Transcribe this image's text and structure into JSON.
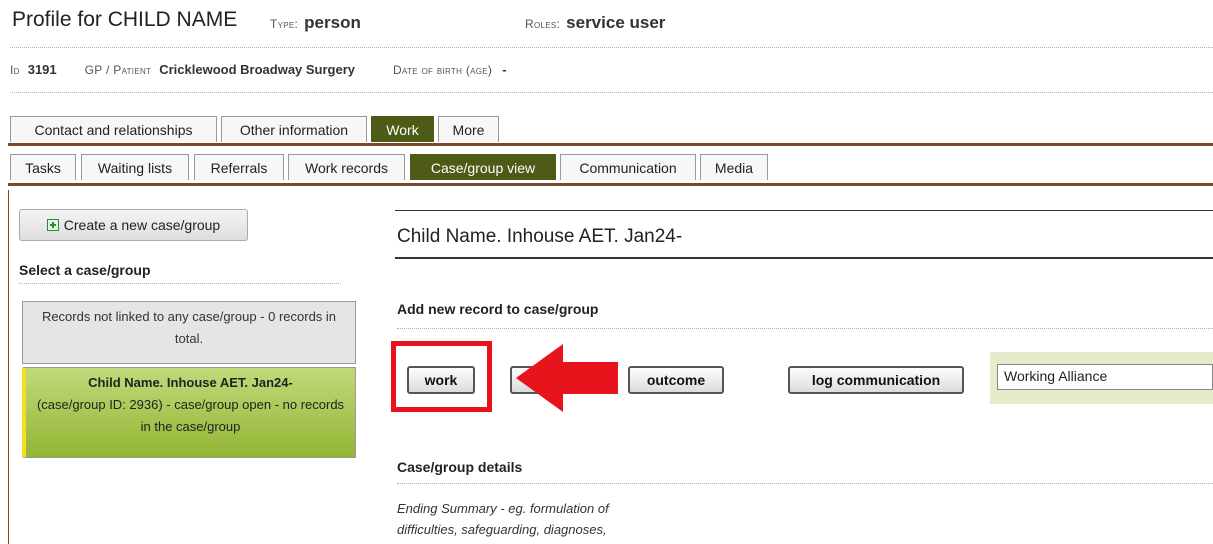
{
  "header": {
    "title": "Profile for CHILD NAME",
    "type_label": "Type:",
    "type_value": "person",
    "roles_label": "Roles:",
    "roles_value": "service user"
  },
  "meta": {
    "id_label": "Id",
    "id_value": "3191",
    "gp_label": "GP / Patient",
    "gp_value": "Cricklewood Broadway Surgery",
    "dob_label": "Date of birth (age)",
    "dob_value": "-"
  },
  "main_tabs": [
    {
      "label": "Contact and relationships",
      "active": false
    },
    {
      "label": "Other information",
      "active": false
    },
    {
      "label": "Work",
      "active": true
    },
    {
      "label": "More",
      "active": false
    }
  ],
  "sub_tabs": [
    {
      "label": "Tasks",
      "active": false
    },
    {
      "label": "Waiting lists",
      "active": false
    },
    {
      "label": "Referrals",
      "active": false
    },
    {
      "label": "Work records",
      "active": false
    },
    {
      "label": "Case/group view",
      "active": true
    },
    {
      "label": "Communication",
      "active": false
    },
    {
      "label": "Media",
      "active": false
    }
  ],
  "left_panel": {
    "create_button": "Create a new case/group",
    "select_heading": "Select a case/group",
    "cases": [
      {
        "text": "Records not linked to any case/group - 0 records in total.",
        "selected": false
      },
      {
        "title": "Child Name. Inhouse AET. Jan24-",
        "text": "(case/group ID: 2936) - case/group open - no records in the case/group",
        "selected": true
      }
    ]
  },
  "main_panel": {
    "case_title": "Child Name. Inhouse AET. Jan24-",
    "add_record_heading": "Add new record to case/group",
    "buttons": {
      "work": "work",
      "outcome": "outcome",
      "log_communication": "log communication"
    },
    "select_value": "Working Alliance",
    "details_heading": "Case/group details",
    "ending_summary": "Ending Summary - eg. formulation of difficulties, safeguarding, diagnoses,"
  },
  "colors": {
    "active_tab": "#4d5b16",
    "tab_bar": "#7a4a2e",
    "selected_case": "#a3c24a",
    "highlight_red": "#e8141c"
  }
}
